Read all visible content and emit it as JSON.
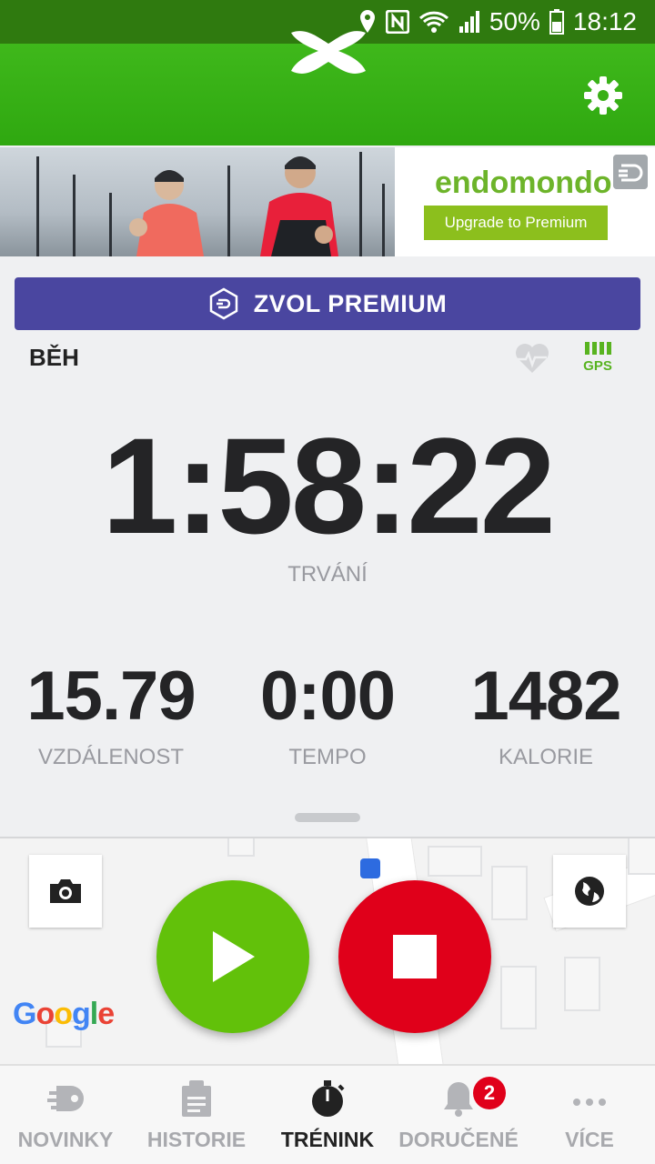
{
  "status_bar": {
    "battery": "50%",
    "time": "18:12"
  },
  "ad": {
    "brand": "endomondo",
    "cta": "Upgrade to Premium"
  },
  "premium_button": {
    "label": "ZVOL PREMIUM"
  },
  "workout": {
    "sport": "BĚH",
    "gps_label": "GPS",
    "duration": {
      "value": "1:58:22",
      "label": "TRVÁNÍ"
    },
    "stats": [
      {
        "value": "15.79",
        "label": "VZDÁLENOST"
      },
      {
        "value": "0:00",
        "label": "TEMPO"
      },
      {
        "value": "1482",
        "label": "KALORIE"
      }
    ]
  },
  "map": {
    "attribution": "Google"
  },
  "nav": {
    "items": [
      {
        "label": "NOVINKY",
        "icon": "news-icon"
      },
      {
        "label": "HISTORIE",
        "icon": "history-icon"
      },
      {
        "label": "TRÉNINK",
        "icon": "stopwatch-icon"
      },
      {
        "label": "DORUČENÉ",
        "icon": "bell-icon",
        "badge": "2"
      },
      {
        "label": "VÍCE",
        "icon": "more-icon"
      }
    ],
    "active_index": 2
  },
  "colors": {
    "header_green": "#3fb81b",
    "premium_purple": "#4a46a0",
    "start_green": "#62c10a",
    "stop_red": "#e0001a"
  }
}
